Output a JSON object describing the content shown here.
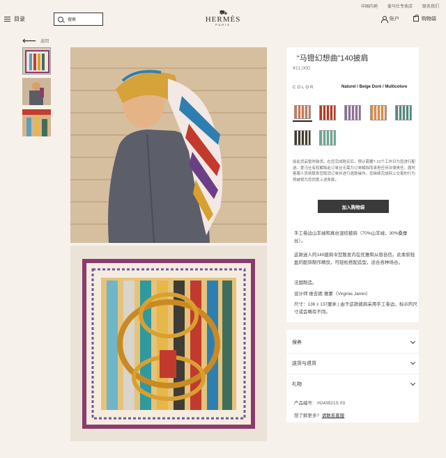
{
  "utility": {
    "links": [
      "中国内地",
      "爱马仕专卖店",
      "联系我们"
    ]
  },
  "header": {
    "menu_label": "目录",
    "search_placeholder": "搜索",
    "logo_text": "HERMÈS",
    "logo_sub": "PARIS",
    "account_label": "账户",
    "bag_label": "购物袋"
  },
  "nav": {
    "back_label": "返回"
  },
  "product": {
    "name": "“马镫幻想曲”140披肩",
    "price": "¥11,000",
    "color_label": "COLOR",
    "color_value": "Naturel / Beige Doré / Multicolore",
    "notice": "如此货品暂时缺货。在您完成购买后，预计需要7-10个工作日为您进行配送。爱马仕有权解除此订单且无需为订单解除而承担任何法律责任。届时客服人员将联系您取消订单并进行退款操作。您继续完成网上交易的行为将被视为您同意上述条款。",
    "add_to_bag": "加入购物袋",
    "description": [
      "手工卷边山羊绒和真丝混纺披肩（70%山羊绒，30%桑蚕丝）。",
      "这款迷人的140披肩令您散发内在优雅和从容自信。此柔软轻盈的配饰制作精良，可轻松搭配造型，适合各种场合。",
      "法国制造。",
      "设计师 维吉妮·雅蒙（Virginie Jamin）",
      "尺寸：136 x 137厘米 | 由于这款披肩采用手工卷边，标示的尺寸或会略有不同。"
    ]
  },
  "swatch_colors": [
    "#c9785a",
    "#b43a2a",
    "#8a6f9e",
    "#d88a4a",
    "#4f8a86",
    "#3d3d36",
    "#6aa69a"
  ],
  "accordion": {
    "items": [
      "保养",
      "送货与退货",
      "礼物"
    ]
  },
  "meta": {
    "sku_label": "产品编号:",
    "sku_value": "H243921S 03",
    "help_text": "想了解更多?",
    "contact_link": "请联系客服"
  }
}
